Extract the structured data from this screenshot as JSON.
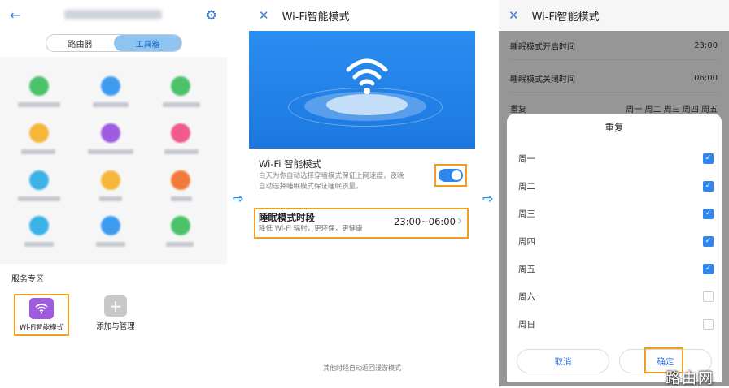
{
  "arrow": "⇨",
  "p1": {
    "back_icon": "←",
    "settings_icon": "⚙",
    "tabs": [
      "路由器",
      "工具箱"
    ],
    "section": "服务专区",
    "wifi_mode_label": "Wi-Fi智能模式",
    "add_icon": "+",
    "add_label": "添加与管理"
  },
  "p2": {
    "close_icon": "✕",
    "title": "Wi-Fi智能模式",
    "mode_title": "Wi-Fi 智能模式",
    "mode_desc_1": "白天为你自动选择穿墙模式保证上网速度，夜晚",
    "mode_desc_2": "自动选择睡眠模式保证睡眠质量。",
    "range_title": "睡眠模式时段",
    "range_value": "23:00~06:00",
    "range_desc": "降低 Wi-Fi 辐射，更环保，更健康",
    "chevron": "›",
    "footnote": "其他时段自动返回漫游模式"
  },
  "p3": {
    "close_icon": "✕",
    "title": "Wi-Fi智能模式",
    "settings": [
      {
        "label": "睡眠模式开启时间",
        "value": "23:00"
      },
      {
        "label": "睡眠模式关闭时间",
        "value": "06:00"
      },
      {
        "label": "重复",
        "value": "周一 周二 周三 周四 周五"
      }
    ],
    "sheet_title": "重复",
    "days": [
      {
        "name": "周一",
        "checked": true
      },
      {
        "name": "周二",
        "checked": true
      },
      {
        "name": "周三",
        "checked": true
      },
      {
        "name": "周四",
        "checked": true
      },
      {
        "name": "周五",
        "checked": true
      },
      {
        "name": "周六",
        "checked": false
      },
      {
        "name": "周日",
        "checked": false
      }
    ],
    "check_glyph": "✓",
    "cancel": "取消",
    "ok": "确定"
  },
  "watermark": "路由网",
  "colors": {
    "accent": "#2f86ef",
    "highlight": "#f0a020",
    "wifi_badge": "#a05ce0"
  }
}
